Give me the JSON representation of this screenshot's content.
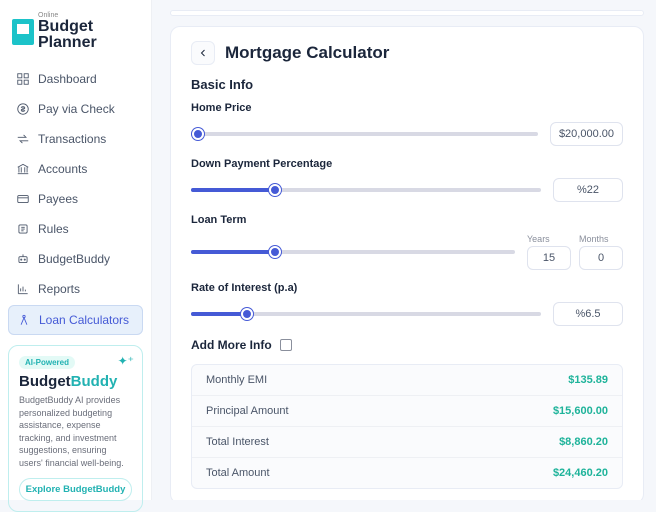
{
  "brand": {
    "pre": "Online",
    "line1": "Budget",
    "line2": "Planner"
  },
  "nav": {
    "items": [
      {
        "label": "Dashboard"
      },
      {
        "label": "Pay via Check"
      },
      {
        "label": "Transactions"
      },
      {
        "label": "Accounts"
      },
      {
        "label": "Payees"
      },
      {
        "label": "Rules"
      },
      {
        "label": "BudgetBuddy"
      },
      {
        "label": "Reports"
      },
      {
        "label": "Loan Calculators"
      }
    ]
  },
  "bb": {
    "badge": "AI-Powered",
    "title_a": "Budget",
    "title_b": "Buddy",
    "desc": "BudgetBuddy AI provides personalized budgeting assistance, expense tracking, and investment suggestions, ensuring users' financial well-being.",
    "btn": "Explore BudgetBuddy"
  },
  "page": {
    "title": "Mortgage Calculator",
    "section": "Basic Info",
    "add_more": "Add More Info"
  },
  "fields": {
    "home_price": {
      "label": "Home Price",
      "value": "$20,000.00",
      "fill": 2
    },
    "down_payment": {
      "label": "Down Payment Percentage",
      "value": "%22",
      "fill": 24
    },
    "loan_term": {
      "label": "Loan Term",
      "years_label": "Years",
      "months_label": "Months",
      "years": "15",
      "months": "0",
      "fill": 26
    },
    "rate": {
      "label": "Rate of Interest (p.a)",
      "value": "%6.5",
      "fill": 16
    }
  },
  "results": {
    "rows": [
      {
        "label": "Monthly EMI",
        "value": "$135.89"
      },
      {
        "label": "Principal Amount",
        "value": "$15,600.00"
      },
      {
        "label": "Total Interest",
        "value": "$8,860.20"
      },
      {
        "label": "Total Amount",
        "value": "$24,460.20"
      }
    ]
  }
}
